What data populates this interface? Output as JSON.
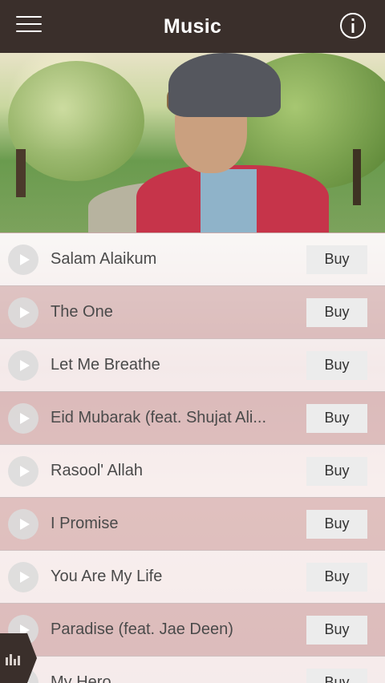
{
  "header": {
    "title": "Music",
    "menu_icon": "hamburger-menu-icon",
    "info_icon": "info-icon",
    "background": "#3a2f2b"
  },
  "songs": [
    {
      "title": "Salam Alaikum",
      "buy_label": "Buy"
    },
    {
      "title": "The One",
      "buy_label": "Buy"
    },
    {
      "title": "Let Me Breathe",
      "buy_label": "Buy"
    },
    {
      "title": "Eid Mubarak (feat. Shujat Ali...",
      "buy_label": "Buy"
    },
    {
      "title": "Rasool' Allah",
      "buy_label": "Buy"
    },
    {
      "title": "I Promise",
      "buy_label": "Buy"
    },
    {
      "title": "You Are My Life",
      "buy_label": "Buy"
    },
    {
      "title": "Paradise (feat. Jae Deen)",
      "buy_label": "Buy"
    },
    {
      "title": "My Hero",
      "buy_label": "Buy"
    }
  ],
  "side_tab_icon": "equalizer-icon"
}
